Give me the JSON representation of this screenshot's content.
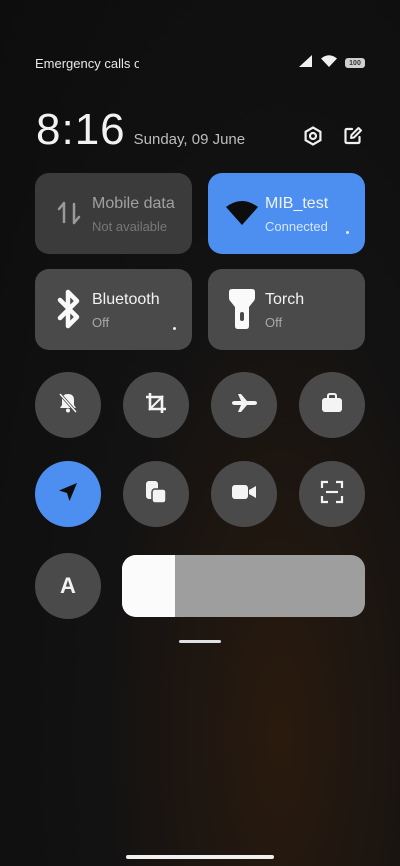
{
  "status_bar": {
    "carrier_text": "Emergency calls o",
    "battery_level": "100",
    "signal_icon": "cell-signal-icon",
    "wifi_icon": "wifi-icon"
  },
  "header": {
    "time": "8:16",
    "date": "Sunday, 09 June",
    "settings_icon": "settings-icon",
    "edit_icon": "edit-icon"
  },
  "tiles": [
    {
      "title": "Mobile data",
      "subtitle": "Not available",
      "icon": "mobile-data-icon",
      "state": "unavailable"
    },
    {
      "title": "MIB_test",
      "subtitle": "Connected",
      "icon": "wifi-icon",
      "state": "active"
    },
    {
      "title": "Bluetooth",
      "subtitle": "Off",
      "icon": "bluetooth-icon",
      "state": "off"
    },
    {
      "title": "Torch",
      "subtitle": "Off",
      "icon": "torch-icon",
      "state": "off"
    }
  ],
  "round_toggles": [
    {
      "icon": "mute-bell-icon",
      "state": "off"
    },
    {
      "icon": "screenshot-crop-icon",
      "state": "off"
    },
    {
      "icon": "airplane-mode-icon",
      "state": "off"
    },
    {
      "icon": "briefcase-icon",
      "state": "off"
    },
    {
      "icon": "location-icon",
      "state": "on"
    },
    {
      "icon": "reading-mode-icon",
      "state": "off"
    },
    {
      "icon": "screen-recorder-icon",
      "state": "off"
    },
    {
      "icon": "scanner-icon",
      "state": "off"
    }
  ],
  "auto_brightness": {
    "label": "A"
  },
  "brightness": {
    "level_percent": 22
  },
  "colors": {
    "accent": "#4d8ff0",
    "tile_bg": "#4a4a4a",
    "background": "#121212"
  }
}
